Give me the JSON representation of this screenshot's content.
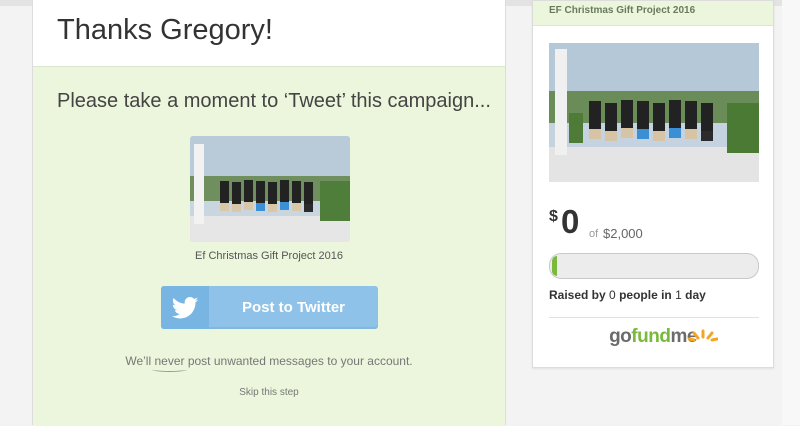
{
  "main": {
    "heading": "Thanks Gregory!",
    "prompt": "Please take a moment to ‘Tweet’ this campaign...",
    "campaign_caption": "Ef Christmas Gift Project 2016",
    "tweet_button_label": "Post to Twitter",
    "never_prefix": "We’ll ",
    "never_word": "never",
    "never_suffix": " post unwanted messages to your account.",
    "skip_label": "Skip this step"
  },
  "sidebar": {
    "campaign_title": "EF Christmas Gift Project 2016",
    "currency_symbol": "$",
    "amount_raised": "0",
    "of_label": "of",
    "goal": "$2,000",
    "progress_percent": 0,
    "raised_prefix": "Raised by",
    "people_count": "0",
    "people_label": "people in",
    "days_count": "1",
    "days_label": "day",
    "logo_part1": "go",
    "logo_part2": "fund",
    "logo_part3": "me"
  },
  "colors": {
    "panel_green": "#ebf6dc",
    "twitter_blue": "#8ec2e9",
    "gofundme_green": "#79b93b"
  },
  "icons": [
    "twitter-bird-icon",
    "gofundme-sun-icon"
  ]
}
